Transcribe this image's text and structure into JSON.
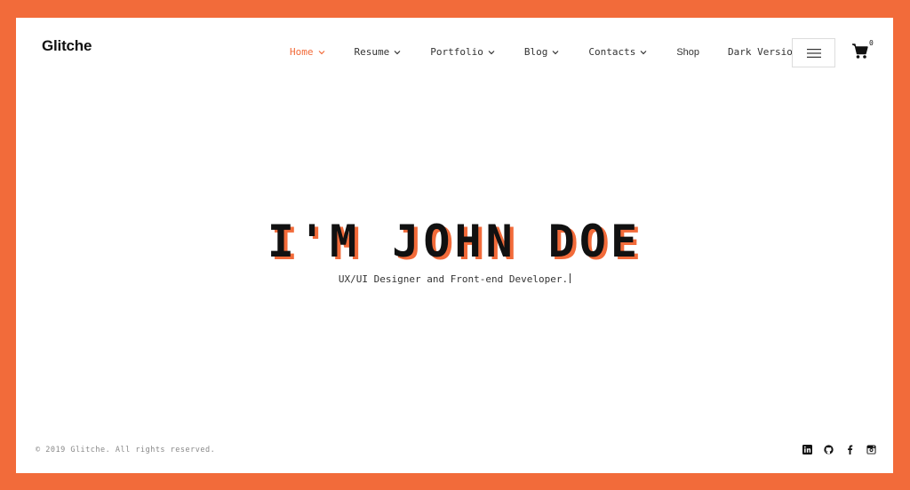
{
  "brand": {
    "logo": "Glitche"
  },
  "nav": {
    "items": [
      {
        "label": "Home",
        "active": true,
        "dropdown": true
      },
      {
        "label": "Resume",
        "active": false,
        "dropdown": true
      },
      {
        "label": "Portfolio",
        "active": false,
        "dropdown": true
      },
      {
        "label": "Blog",
        "active": false,
        "dropdown": true
      },
      {
        "label": "Contacts",
        "active": false,
        "dropdown": true
      },
      {
        "label": "Shop",
        "active": false,
        "dropdown": false
      },
      {
        "label": "Dark Version",
        "active": false,
        "dropdown": false
      }
    ]
  },
  "header": {
    "menu_icon": "hamburger-icon",
    "cart_icon": "cart-icon",
    "cart_count": "0"
  },
  "hero": {
    "title": "I'M JOHN DOE",
    "subtitle": "UX/UI Designer and Front-end Developer."
  },
  "footer": {
    "copyright": "© 2019 Glitche. All rights reserved.",
    "social_icons": [
      "linkedin-icon",
      "github-icon",
      "facebook-icon",
      "instagram-icon"
    ]
  },
  "colors": {
    "accent": "#f26b3a",
    "text": "#111111",
    "background": "#ffffff"
  }
}
